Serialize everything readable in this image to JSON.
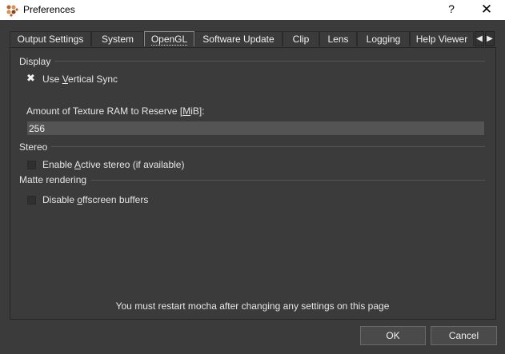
{
  "window": {
    "title": "Preferences",
    "help_label": "?",
    "close_label": "✕"
  },
  "tabs": [
    {
      "label": "Output Settings"
    },
    {
      "label": "System"
    },
    {
      "label": "OpenGL",
      "active": true
    },
    {
      "label": "Software Update"
    },
    {
      "label": "Clip"
    },
    {
      "label": "Lens"
    },
    {
      "label": "Logging"
    },
    {
      "label": "Help Viewer"
    }
  ],
  "tab_scroll": {
    "left": "◀",
    "right": "▶"
  },
  "display": {
    "title": "Display",
    "vsync": {
      "label_pre": "Use ",
      "label_key": "V",
      "label_post": "ertical Sync",
      "checked": true
    },
    "texture_ram": {
      "label_pre": "Amount of Texture RAM to Reserve [",
      "label_key": "M",
      "label_post": "iB]:",
      "value": "256"
    }
  },
  "stereo": {
    "title": "Stereo",
    "active": {
      "label_pre": "Enable ",
      "label_key": "A",
      "label_post": "ctive stereo (if available)",
      "checked": false
    }
  },
  "matte": {
    "title": "Matte rendering",
    "offscreen": {
      "label_pre": "Disable ",
      "label_key": "o",
      "label_post": "ffscreen buffers",
      "checked": false
    }
  },
  "footer_note": "You must restart mocha after changing any settings on this page",
  "buttons": {
    "ok": "OK",
    "cancel": "Cancel"
  }
}
